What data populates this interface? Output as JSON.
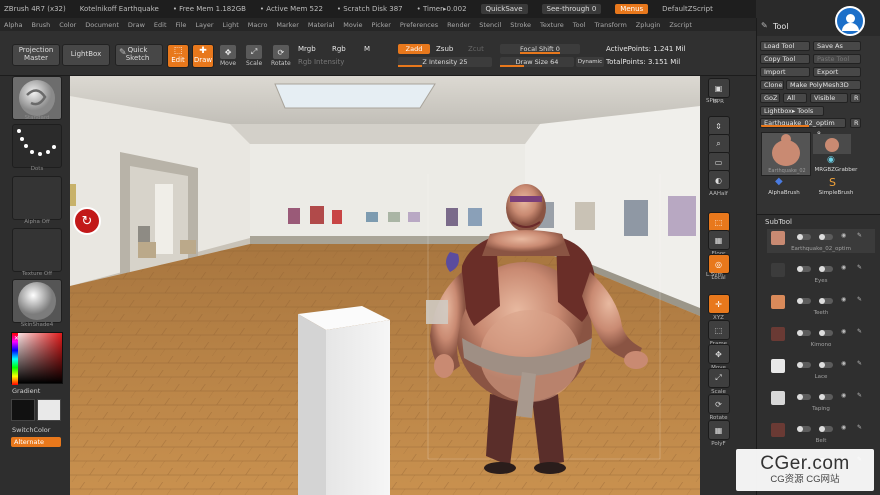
{
  "titlebar": {
    "app": "ZBrush 4R7 (x32)",
    "doc": "Kotelnikoff Earthquake",
    "free_mem": "• Free Mem 1.182GB",
    "active_mem": "• Active Mem 522",
    "scratch": "• Scratch Disk 387",
    "timer": "• Timer▸0.002",
    "quicksave": "QuickSave",
    "seethrough": "See-through  0",
    "menus": "Menus",
    "script": "DefaultZScript"
  },
  "menubar": [
    "Alpha",
    "Brush",
    "Color",
    "Document",
    "Draw",
    "Edit",
    "File",
    "Layer",
    "Light",
    "Macro",
    "Marker",
    "Material",
    "Movie",
    "Picker",
    "Preferences",
    "Render",
    "Stencil",
    "Stroke",
    "Texture",
    "Tool",
    "Transform",
    "Zplugin",
    "Zscript"
  ],
  "shelf": {
    "projection_master": "Projection Master",
    "lightbox": "LightBox",
    "quick_sketch": "Quick Sketch",
    "edit": "Edit",
    "draw": "Draw",
    "move": "Move",
    "scale": "Scale",
    "rotate": "Rotate",
    "mrgb": "Mrgb",
    "rgb": "Rgb",
    "m": "M",
    "rgb_intensity": "Rgb Intensity",
    "zadd": "Zadd",
    "zsub": "Zsub",
    "zcut": "Zcut",
    "z_intensity": "Z Intensity 25",
    "z_intensity_value": 25,
    "focal_shift": "Focal Shift 0",
    "draw_size": "Draw Size 64",
    "draw_size_value": 64,
    "dynamic": "Dynamic",
    "active_points": "ActivePoints: 1.241  Mil",
    "total_points": "TotalPoints: 3.151  Mil"
  },
  "lefttray": {
    "brush": "Standard",
    "stroke": "Dots",
    "alpha": "Alpha  Off",
    "texture": "Texture  Off",
    "material": "SkinShade4",
    "gradient": "Gradient",
    "switchcolor": "SwitchColor",
    "alternate": "Alternate"
  },
  "rightcol": [
    "BPR",
    "SPix",
    "Scroll",
    "Zoom",
    "Actual",
    "AAHalf",
    "Persp",
    "Floor",
    "Local",
    "L.Sym",
    "XYZ",
    "Frame",
    "Move",
    "Scale",
    "Rotate",
    "PolyF"
  ],
  "tool": {
    "title": "Tool",
    "load": "Load Tool",
    "save": "Save As",
    "copy": "Copy Tool",
    "paste": "Paste Tool",
    "import": "Import",
    "export": "Export",
    "clone": "Clone",
    "make_polymesh": "Make PolyMesh3D",
    "goz": "GoZ",
    "all": "All",
    "visible": "Visible",
    "r": "R",
    "lightbox_tools": "Lightbox▸ Tools",
    "current_tool": "Earthquake_02_optim",
    "current_tool_count": "48",
    "thumb1": "Earthquake_02",
    "thumb2": "MRGBZGrabber",
    "thumb3": "AlphaBrush",
    "thumb4": "SimpleBrush",
    "thumb_count": "8",
    "subtool_title": "SubTool",
    "subtools": [
      {
        "name": "Earthquake_02_optim"
      },
      {
        "name": "Eyes"
      },
      {
        "name": "Teeth"
      },
      {
        "name": "Kimono"
      },
      {
        "name": "Lace"
      },
      {
        "name": "Taping"
      },
      {
        "name": "Belt"
      },
      {
        "name": "Shoes"
      }
    ]
  },
  "watermark": {
    "line1": "CGer.com",
    "line2": "CG资源 CG网站"
  }
}
